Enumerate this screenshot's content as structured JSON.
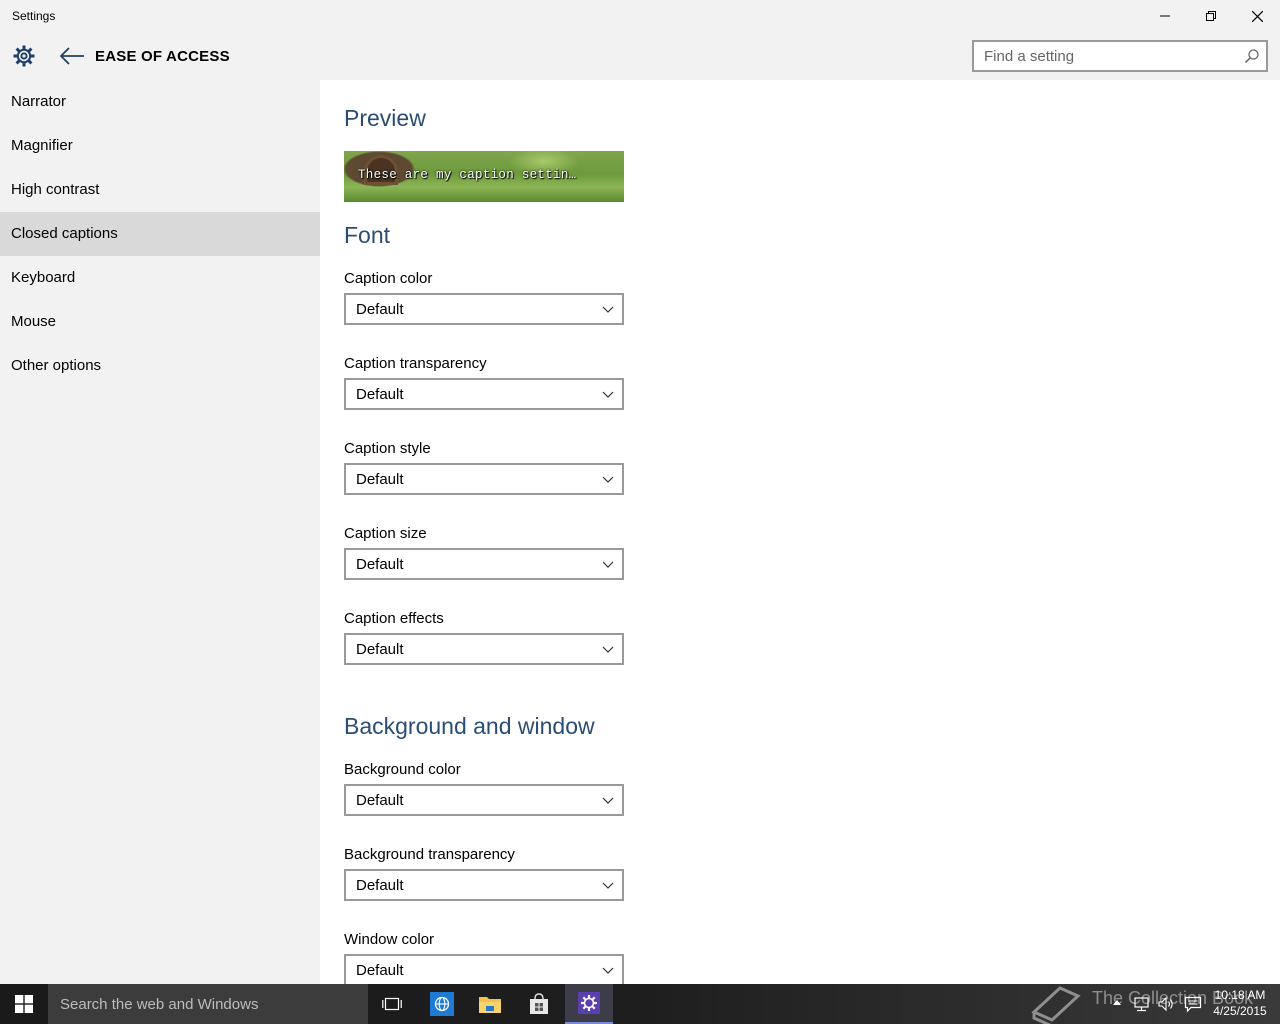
{
  "window": {
    "title": "Settings"
  },
  "header": {
    "section_title": "EASE OF ACCESS",
    "search_placeholder": "Find a setting"
  },
  "sidebar": {
    "items": [
      {
        "label": "Narrator"
      },
      {
        "label": "Magnifier"
      },
      {
        "label": "High contrast"
      },
      {
        "label": "Closed captions",
        "selected": true
      },
      {
        "label": "Keyboard"
      },
      {
        "label": "Mouse"
      },
      {
        "label": "Other options"
      }
    ]
  },
  "main": {
    "preview": {
      "heading": "Preview",
      "caption_text": "These are my caption settin…"
    },
    "font": {
      "heading": "Font",
      "fields": [
        {
          "label": "Caption color",
          "value": "Default"
        },
        {
          "label": "Caption transparency",
          "value": "Default"
        },
        {
          "label": "Caption style",
          "value": "Default"
        },
        {
          "label": "Caption size",
          "value": "Default"
        },
        {
          "label": "Caption effects",
          "value": "Default"
        }
      ]
    },
    "background": {
      "heading": "Background and window",
      "fields": [
        {
          "label": "Background color",
          "value": "Default"
        },
        {
          "label": "Background transparency",
          "value": "Default"
        },
        {
          "label": "Window color",
          "value": "Default"
        }
      ]
    }
  },
  "taskbar": {
    "search_placeholder": "Search the web and Windows",
    "watermark": "The Collection Book",
    "clock_time": "10:18 AM",
    "clock_date": "4/25/2015",
    "pinned": [
      "task-view-icon",
      "internet-explorer-icon",
      "file-explorer-icon",
      "store-icon",
      "settings-icon"
    ]
  },
  "colors": {
    "accent_heading": "#2b4d73",
    "sidebar_bg": "#f2f2f2",
    "sidebar_selected": "#d9d9d9",
    "taskbar_bg": "#1e1e1e"
  }
}
